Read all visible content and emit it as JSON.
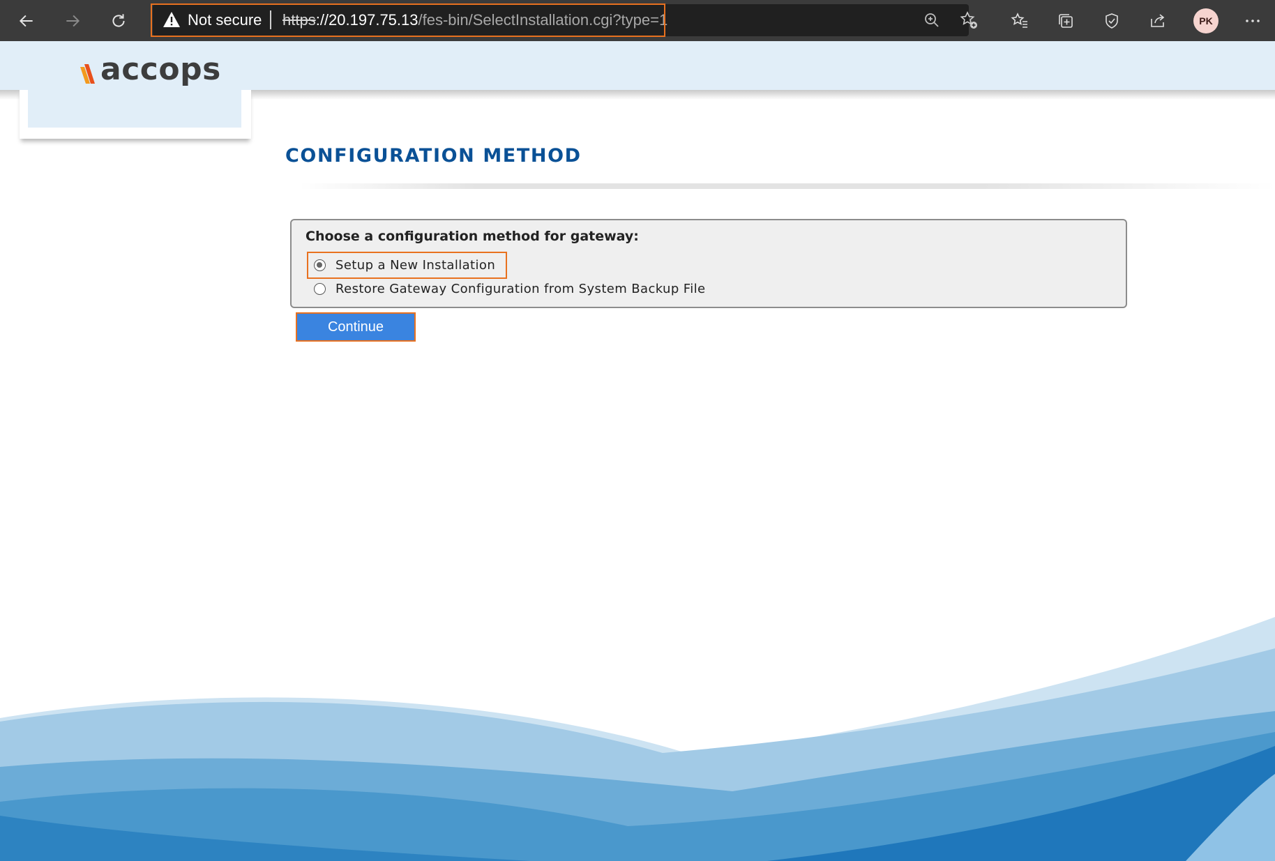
{
  "browser": {
    "security_label": "Not secure",
    "url": {
      "scheme": "https",
      "host": "://20.197.75.13",
      "path": "/fes-bin/SelectInstallation.cgi?type=1"
    },
    "profile_initials": "PK",
    "icons": [
      "back-arrow-icon",
      "forward-arrow-icon",
      "refresh-icon",
      "warning-icon",
      "zoom-icon",
      "add-favorite-icon",
      "favorites-icon",
      "collections-icon",
      "performance-icon",
      "share-icon",
      "more-icon"
    ]
  },
  "brand": {
    "logo_text": "accops",
    "accent_color": "#e8711f"
  },
  "page": {
    "title": "CONFIGURATION METHOD",
    "config": {
      "prompt": "Choose a configuration method for gateway:",
      "options": [
        {
          "label": "Setup a New Installation",
          "selected": true
        },
        {
          "label": "Restore Gateway Configuration from System Backup File",
          "selected": false
        }
      ]
    },
    "continue_label": "Continue"
  }
}
